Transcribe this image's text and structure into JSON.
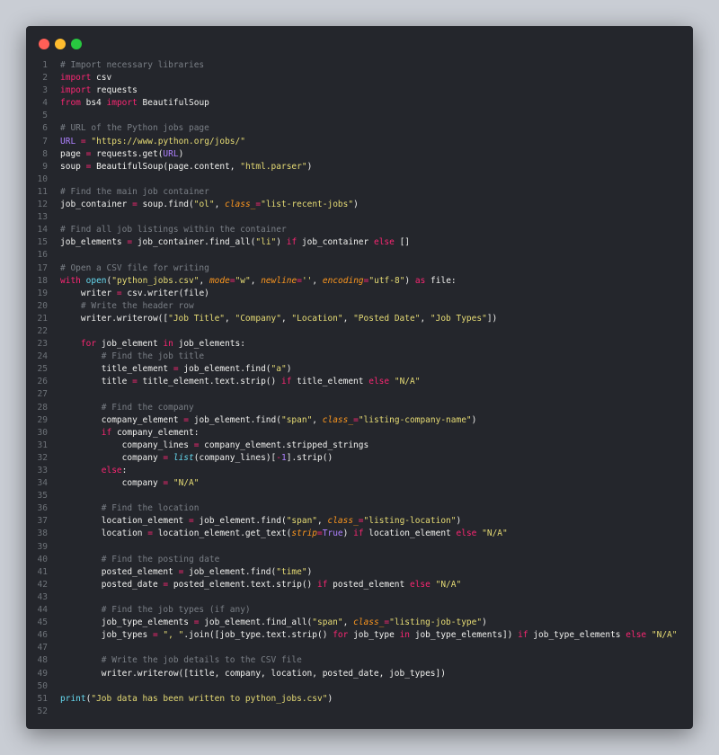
{
  "window": {
    "buttons": [
      {
        "name": "close-button",
        "color": "#ff5f57"
      },
      {
        "name": "minimize-button",
        "color": "#febc2e"
      },
      {
        "name": "maximize-button",
        "color": "#28c840"
      }
    ]
  },
  "editor": {
    "language": "python",
    "lines": [
      [
        [
          "cm",
          "# Import necessary libraries"
        ]
      ],
      [
        [
          "kw",
          "import"
        ],
        [
          "id",
          " csv"
        ]
      ],
      [
        [
          "kw",
          "import"
        ],
        [
          "id",
          " requests"
        ]
      ],
      [
        [
          "kw",
          "from"
        ],
        [
          "id",
          " bs4 "
        ],
        [
          "kw",
          "import"
        ],
        [
          "id",
          " BeautifulSoup"
        ]
      ],
      [],
      [
        [
          "cm",
          "# URL of the Python jobs page"
        ]
      ],
      [
        [
          "nm",
          "URL"
        ],
        [
          "id",
          " "
        ],
        [
          "kw",
          "="
        ],
        [
          "id",
          " "
        ],
        [
          "st",
          "\"https://www.python.org/jobs/\""
        ]
      ],
      [
        [
          "id",
          "page "
        ],
        [
          "kw",
          "="
        ],
        [
          "id",
          " requests.get("
        ],
        [
          "nm",
          "URL"
        ],
        [
          "id",
          ")"
        ]
      ],
      [
        [
          "id",
          "soup "
        ],
        [
          "kw",
          "="
        ],
        [
          "id",
          " BeautifulSoup(page.content, "
        ],
        [
          "st",
          "\"html.parser\""
        ],
        [
          "id",
          ")"
        ]
      ],
      [],
      [
        [
          "cm",
          "# Find the main job container"
        ]
      ],
      [
        [
          "id",
          "job_container "
        ],
        [
          "kw",
          "="
        ],
        [
          "id",
          " soup.find("
        ],
        [
          "st",
          "\"ol\""
        ],
        [
          "id",
          ", "
        ],
        [
          "it",
          "class_"
        ],
        [
          "kw",
          "="
        ],
        [
          "st",
          "\"list-recent-jobs\""
        ],
        [
          "id",
          ")"
        ]
      ],
      [],
      [
        [
          "cm",
          "# Find all job listings within the container"
        ]
      ],
      [
        [
          "id",
          "job_elements "
        ],
        [
          "kw",
          "="
        ],
        [
          "id",
          " job_container.find_all("
        ],
        [
          "st",
          "\"li\""
        ],
        [
          "id",
          ") "
        ],
        [
          "kw",
          "if"
        ],
        [
          "id",
          " job_container "
        ],
        [
          "kw",
          "else"
        ],
        [
          "id",
          " []"
        ]
      ],
      [],
      [
        [
          "cm",
          "# Open a CSV file for writing"
        ]
      ],
      [
        [
          "kw",
          "with"
        ],
        [
          "id",
          " "
        ],
        [
          "bi",
          "open"
        ],
        [
          "id",
          "("
        ],
        [
          "st",
          "\"python_jobs.csv\""
        ],
        [
          "id",
          ", "
        ],
        [
          "it",
          "mode"
        ],
        [
          "kw",
          "="
        ],
        [
          "st",
          "\"w\""
        ],
        [
          "id",
          ", "
        ],
        [
          "it",
          "newline"
        ],
        [
          "kw",
          "="
        ],
        [
          "st",
          "''"
        ],
        [
          "id",
          ", "
        ],
        [
          "it",
          "encoding"
        ],
        [
          "kw",
          "="
        ],
        [
          "st",
          "\"utf-8\""
        ],
        [
          "id",
          ") "
        ],
        [
          "kw",
          "as"
        ],
        [
          "id",
          " file:"
        ]
      ],
      [
        [
          "id",
          "    writer "
        ],
        [
          "kw",
          "="
        ],
        [
          "id",
          " csv.writer(file)"
        ]
      ],
      [
        [
          "id",
          "    "
        ],
        [
          "cm",
          "# Write the header row"
        ]
      ],
      [
        [
          "id",
          "    writer.writerow(["
        ],
        [
          "st",
          "\"Job Title\""
        ],
        [
          "id",
          ", "
        ],
        [
          "st",
          "\"Company\""
        ],
        [
          "id",
          ", "
        ],
        [
          "st",
          "\"Location\""
        ],
        [
          "id",
          ", "
        ],
        [
          "st",
          "\"Posted Date\""
        ],
        [
          "id",
          ", "
        ],
        [
          "st",
          "\"Job Types\""
        ],
        [
          "id",
          "])"
        ]
      ],
      [],
      [
        [
          "id",
          "    "
        ],
        [
          "kw",
          "for"
        ],
        [
          "id",
          " job_element "
        ],
        [
          "kw",
          "in"
        ],
        [
          "id",
          " job_elements:"
        ]
      ],
      [
        [
          "id",
          "        "
        ],
        [
          "cm",
          "# Find the job title"
        ]
      ],
      [
        [
          "id",
          "        title_element "
        ],
        [
          "kw",
          "="
        ],
        [
          "id",
          " job_element.find("
        ],
        [
          "st",
          "\"a\""
        ],
        [
          "id",
          ")"
        ]
      ],
      [
        [
          "id",
          "        title "
        ],
        [
          "kw",
          "="
        ],
        [
          "id",
          " title_element.text.strip() "
        ],
        [
          "kw",
          "if"
        ],
        [
          "id",
          " title_element "
        ],
        [
          "kw",
          "else"
        ],
        [
          "id",
          " "
        ],
        [
          "st",
          "\"N/A\""
        ]
      ],
      [],
      [
        [
          "id",
          "        "
        ],
        [
          "cm",
          "# Find the company"
        ]
      ],
      [
        [
          "id",
          "        company_element "
        ],
        [
          "kw",
          "="
        ],
        [
          "id",
          " job_element.find("
        ],
        [
          "st",
          "\"span\""
        ],
        [
          "id",
          ", "
        ],
        [
          "it",
          "class_"
        ],
        [
          "kw",
          "="
        ],
        [
          "st",
          "\"listing-company-name\""
        ],
        [
          "id",
          ")"
        ]
      ],
      [
        [
          "id",
          "        "
        ],
        [
          "kw",
          "if"
        ],
        [
          "id",
          " company_element:"
        ]
      ],
      [
        [
          "id",
          "            company_lines "
        ],
        [
          "kw",
          "="
        ],
        [
          "id",
          " company_element.stripped_strings"
        ]
      ],
      [
        [
          "id",
          "            company "
        ],
        [
          "kw",
          "="
        ],
        [
          "id",
          " "
        ],
        [
          "bic",
          "list"
        ],
        [
          "id",
          "(company_lines)["
        ],
        [
          "kw",
          "-"
        ],
        [
          "nm",
          "1"
        ],
        [
          "id",
          "].strip()"
        ]
      ],
      [
        [
          "id",
          "        "
        ],
        [
          "kw",
          "else"
        ],
        [
          "id",
          ":"
        ]
      ],
      [
        [
          "id",
          "            company "
        ],
        [
          "kw",
          "="
        ],
        [
          "id",
          " "
        ],
        [
          "st",
          "\"N/A\""
        ]
      ],
      [],
      [
        [
          "id",
          "        "
        ],
        [
          "cm",
          "# Find the location"
        ]
      ],
      [
        [
          "id",
          "        location_element "
        ],
        [
          "kw",
          "="
        ],
        [
          "id",
          " job_element.find("
        ],
        [
          "st",
          "\"span\""
        ],
        [
          "id",
          ", "
        ],
        [
          "it",
          "class_"
        ],
        [
          "kw",
          "="
        ],
        [
          "st",
          "\"listing-location\""
        ],
        [
          "id",
          ")"
        ]
      ],
      [
        [
          "id",
          "        location "
        ],
        [
          "kw",
          "="
        ],
        [
          "id",
          " location_element.get_text("
        ],
        [
          "it",
          "strip"
        ],
        [
          "kw",
          "="
        ],
        [
          "nm",
          "True"
        ],
        [
          "id",
          ") "
        ],
        [
          "kw",
          "if"
        ],
        [
          "id",
          " location_element "
        ],
        [
          "kw",
          "else"
        ],
        [
          "id",
          " "
        ],
        [
          "st",
          "\"N/A\""
        ]
      ],
      [],
      [
        [
          "id",
          "        "
        ],
        [
          "cm",
          "# Find the posting date"
        ]
      ],
      [
        [
          "id",
          "        posted_element "
        ],
        [
          "kw",
          "="
        ],
        [
          "id",
          " job_element.find("
        ],
        [
          "st",
          "\"time\""
        ],
        [
          "id",
          ")"
        ]
      ],
      [
        [
          "id",
          "        posted_date "
        ],
        [
          "kw",
          "="
        ],
        [
          "id",
          " posted_element.text.strip() "
        ],
        [
          "kw",
          "if"
        ],
        [
          "id",
          " posted_element "
        ],
        [
          "kw",
          "else"
        ],
        [
          "id",
          " "
        ],
        [
          "st",
          "\"N/A\""
        ]
      ],
      [],
      [
        [
          "id",
          "        "
        ],
        [
          "cm",
          "# Find the job types (if any)"
        ]
      ],
      [
        [
          "id",
          "        job_type_elements "
        ],
        [
          "kw",
          "="
        ],
        [
          "id",
          " job_element.find_all("
        ],
        [
          "st",
          "\"span\""
        ],
        [
          "id",
          ", "
        ],
        [
          "it",
          "class_"
        ],
        [
          "kw",
          "="
        ],
        [
          "st",
          "\"listing-job-type\""
        ],
        [
          "id",
          ")"
        ]
      ],
      [
        [
          "id",
          "        job_types "
        ],
        [
          "kw",
          "="
        ],
        [
          "id",
          " "
        ],
        [
          "st",
          "\", \""
        ],
        [
          "id",
          ".join([job_type.text.strip() "
        ],
        [
          "kw",
          "for"
        ],
        [
          "id",
          " job_type "
        ],
        [
          "kw",
          "in"
        ],
        [
          "id",
          " job_type_elements]) "
        ],
        [
          "kw",
          "if"
        ],
        [
          "id",
          " job_type_elements "
        ],
        [
          "kw",
          "else"
        ],
        [
          "id",
          " "
        ],
        [
          "st",
          "\"N/A\""
        ]
      ],
      [],
      [
        [
          "id",
          "        "
        ],
        [
          "cm",
          "# Write the job details to the CSV file"
        ]
      ],
      [
        [
          "id",
          "        writer.writerow([title, company, location, posted_date, job_types])"
        ]
      ],
      [],
      [
        [
          "bi",
          "print"
        ],
        [
          "id",
          "("
        ],
        [
          "st",
          "\"Job data has been written to python_jobs.csv\""
        ],
        [
          "id",
          ")"
        ]
      ],
      []
    ]
  }
}
